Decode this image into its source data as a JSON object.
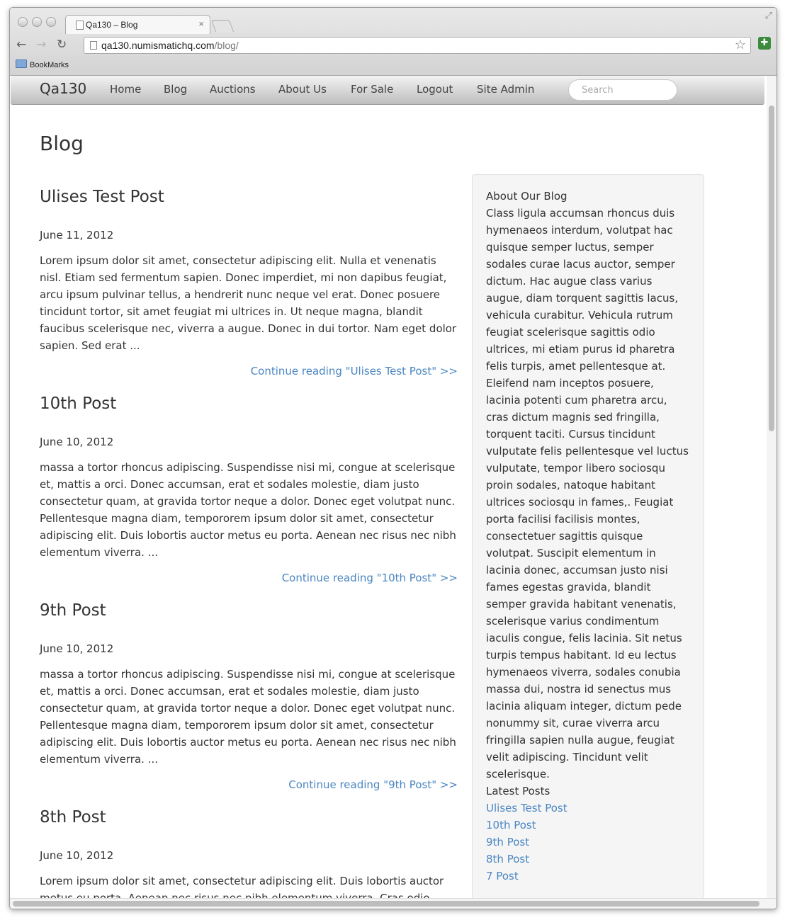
{
  "browser": {
    "tab_title": "Qa130 – Blog",
    "tab_close": "×",
    "url_host": "qa130.numismatichq.com",
    "url_path": "/blog/",
    "bookmark_folder": "BookMarks"
  },
  "navbar": {
    "brand": "Qa130",
    "items": [
      "Home",
      "Blog",
      "Auctions",
      "About Us",
      "For Sale",
      "Logout",
      "Site Admin"
    ],
    "search_placeholder": "Search"
  },
  "page": {
    "title": "Blog"
  },
  "posts": [
    {
      "title": "Ulises Test Post",
      "date": "June 11, 2012",
      "excerpt": "Lorem ipsum dolor sit amet, consectetur adipiscing elit. Nulla et venenatis nisl. Etiam sed fermentum sapien. Donec imperdiet, mi non dapibus feugiat, arcu ipsum pulvinar tellus, a hendrerit nunc neque vel erat. Donec posuere tincidunt tortor, sit amet feugiat mi ultrices in. Ut neque magna, blandit faucibus scelerisque nec, viverra a augue. Donec in dui tortor. Nam eget dolor sapien. Sed erat ...",
      "read_more": "Continue reading \"Ulises Test Post\" >>"
    },
    {
      "title": "10th Post",
      "date": "June 10, 2012",
      "excerpt": "massa a tortor rhoncus adipiscing. Suspendisse nisi mi, congue at scelerisque et, mattis a orci. Donec accumsan, erat et sodales molestie, diam justo consectetur quam, at gravida tortor neque a dolor. Donec eget volutpat nunc. Pellentesque magna diam, tempororem ipsum dolor sit amet, consectetur adipiscing elit. Duis lobortis auctor metus eu porta. Aenean nec risus nec nibh elementum viverra. ...",
      "read_more": "Continue reading \"10th Post\" >>"
    },
    {
      "title": "9th Post",
      "date": "June 10, 2012",
      "excerpt": "massa a tortor rhoncus adipiscing. Suspendisse nisi mi, congue at scelerisque et, mattis a orci. Donec accumsan, erat et sodales molestie, diam justo consectetur quam, at gravida tortor neque a dolor. Donec eget volutpat nunc. Pellentesque magna diam, tempororem ipsum dolor sit amet, consectetur adipiscing elit. Duis lobortis auctor metus eu porta. Aenean nec risus nec nibh elementum viverra. ...",
      "read_more": "Continue reading \"9th Post\" >>"
    },
    {
      "title": "8th Post",
      "date": "June 10, 2012",
      "excerpt": "Lorem ipsum dolor sit amet, consectetur adipiscing elit. Duis lobortis auctor metus eu porta. Aenean nec risus nec nibh elementum viverra. Cras odio lorem, vestibulum at interdum eu, gravida eget urna. Sed volutpat dictum mauris ut congue. Morbi et massa a tortor rhoncus adipiscing. Suspendisse",
      "read_more": ""
    }
  ],
  "sidebar": {
    "about_heading": "About Our Blog",
    "about_text": "Class ligula accumsan rhoncus duis hymenaeos interdum, volutpat hac quisque semper luctus, semper sodales curae lacus auctor, semper dictum. Hac augue class varius augue, diam torquent sagittis lacus, vehicula curabitur. Vehicula rutrum feugiat scelerisque sagittis odio ultrices, mi etiam purus id pharetra felis turpis, amet pellentesque at. Eleifend nam inceptos posuere, lacinia potenti cum pharetra arcu, cras dictum magnis sed fringilla, torquent taciti. Cursus tincidunt vulputate felis pellentesque vel luctus vulputate, tempor libero sociosqu proin sodales, natoque habitant ultrices sociosqu in fames,. Feugiat porta facilisi facilisis montes, consectetuer sagittis quisque volutpat. Suscipit elementum in lacinia donec, accumsan justo nisi fames egestas gravida, blandit semper gravida habitant venenatis, scelerisque varius condimentum iaculis congue, felis lacinia. Sit netus turpis tempus habitant. Id eu lectus hymenaeos viverra, sodales conubia massa dui, nostra id senectus mus lacinia aliquam integer, dictum pede nonummy sit, curae viverra arcu fringilla sapien nulla augue, feugiat velit adipiscing. Tincidunt velit scelerisque.",
    "latest_heading": "Latest Posts",
    "latest": [
      "Ulises Test Post",
      "10th Post",
      "9th Post",
      "8th Post",
      "7 Post"
    ]
  },
  "colors": {
    "link": "#4b86c2",
    "text": "#333333",
    "sidebar_bg": "#f5f5f5"
  }
}
